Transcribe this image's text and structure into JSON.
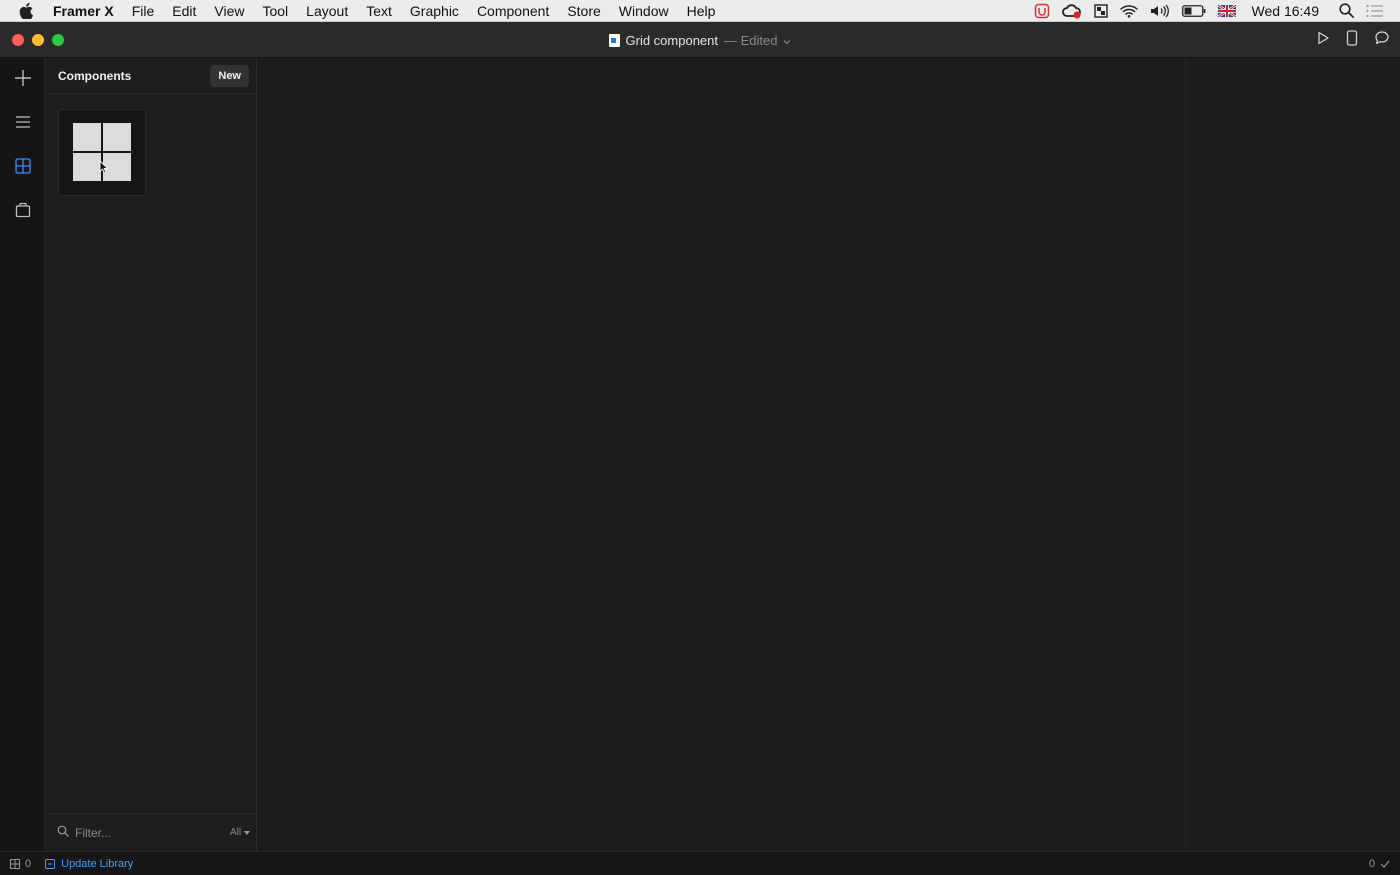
{
  "menubar": {
    "app_name": "Framer X",
    "items": [
      "File",
      "Edit",
      "View",
      "Tool",
      "Layout",
      "Text",
      "Graphic",
      "Component",
      "Store",
      "Window",
      "Help"
    ],
    "clock": "Wed 16:49"
  },
  "window": {
    "document_title": "Grid component",
    "edited_label": "— Edited"
  },
  "panel": {
    "title": "Components",
    "new_button": "New",
    "filter_placeholder": "Filter...",
    "filter_scope": "All"
  },
  "statusbar": {
    "left_count": "0",
    "update_library": "Update Library",
    "right_count": "0"
  },
  "colors": {
    "accent": "#4a9bff",
    "traffic_close": "#fe5f57",
    "traffic_minimize": "#febc2e",
    "traffic_zoom": "#28c840"
  }
}
